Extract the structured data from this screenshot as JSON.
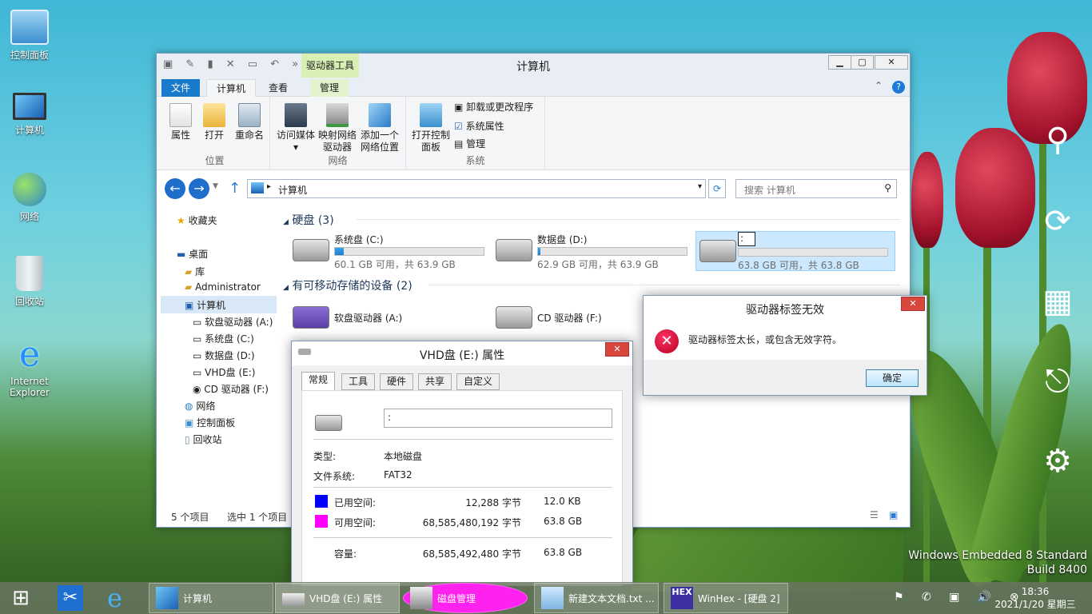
{
  "desktop": {
    "icons": [
      {
        "label": "控制面板"
      },
      {
        "label": "计算机"
      },
      {
        "label": "网络"
      },
      {
        "label": "回收站"
      },
      {
        "label": "Internet Explorer"
      }
    ],
    "watermark_line1": "Windows Embedded 8 Standard",
    "watermark_line2": "Build 8400"
  },
  "explorer": {
    "title": "计算机",
    "context_tab": "驱动器工具",
    "tabs": [
      "文件",
      "计算机",
      "查看",
      "管理"
    ],
    "ribbon": {
      "group1": {
        "label": "位置",
        "buttons": [
          "属性",
          "打开",
          "重命名"
        ]
      },
      "group2": {
        "label": "网络",
        "buttons": [
          "访问媒体",
          "映射网络驱动器",
          "添加一个网络位置"
        ]
      },
      "group3": {
        "label": "系统",
        "open": "打开控制面板",
        "items": [
          "卸载或更改程序",
          "系统属性",
          "管理"
        ]
      }
    },
    "address": "计算机",
    "search_placeholder": "搜索 计算机",
    "nav": [
      "收藏夹",
      "桌面",
      "库",
      "Administrator",
      "计算机",
      "软盘驱动器 (A:)",
      "系统盘 (C:)",
      "数据盘 (D:)",
      "VHD盘 (E:)",
      "CD 驱动器 (F:)",
      "网络",
      "控制面板",
      "回收站"
    ],
    "section_hdd": "硬盘 (3)",
    "section_removable": "有可移动存储的设备 (2)",
    "drives": [
      {
        "name": "系统盘 (C:)",
        "info": "60.1 GB 可用，共 63.9 GB",
        "used": 0.06
      },
      {
        "name": "数据盘 (D:)",
        "info": "62.9 GB 可用，共 63.9 GB",
        "used": 0.016
      },
      {
        "name": ":",
        "info": "63.8 GB 可用，共 63.8 GB",
        "used": 0.0
      }
    ],
    "removable": [
      {
        "name": "软盘驱动器 (A:)"
      },
      {
        "name": "CD 驱动器 (F:)"
      }
    ],
    "status_items": "5 个项目",
    "status_selected": "选中 1 个项目"
  },
  "props": {
    "title": "VHD盘 (E:) 属性",
    "tabs": [
      "常规",
      "工具",
      "硬件",
      "共享",
      "自定义"
    ],
    "label_value": ":",
    "type_label": "类型:",
    "type_value": "本地磁盘",
    "fs_label": "文件系统:",
    "fs_value": "FAT32",
    "used_label": "已用空间:",
    "used_bytes": "12,288 字节",
    "used_size": "12.0 KB",
    "free_label": "可用空间:",
    "free_bytes": "68,585,480,192 字节",
    "free_size": "63.8 GB",
    "cap_label": "容量:",
    "cap_bytes": "68,585,492,480 字节",
    "cap_size": "63.8 GB",
    "used_color": "#0000ff",
    "free_color": "#ff00ff"
  },
  "error": {
    "title": "驱动器标签无效",
    "message": "驱动器标签太长，或包含无效字符。",
    "ok": "确定"
  },
  "taskbar": {
    "items": [
      "计算机",
      "VHD盘 (E:) 属性",
      "磁盘管理",
      "新建文本文档.txt ...",
      "WinHex - [硬盘 2]"
    ],
    "time": "18:36",
    "date": "2021/1/20 星期三"
  }
}
